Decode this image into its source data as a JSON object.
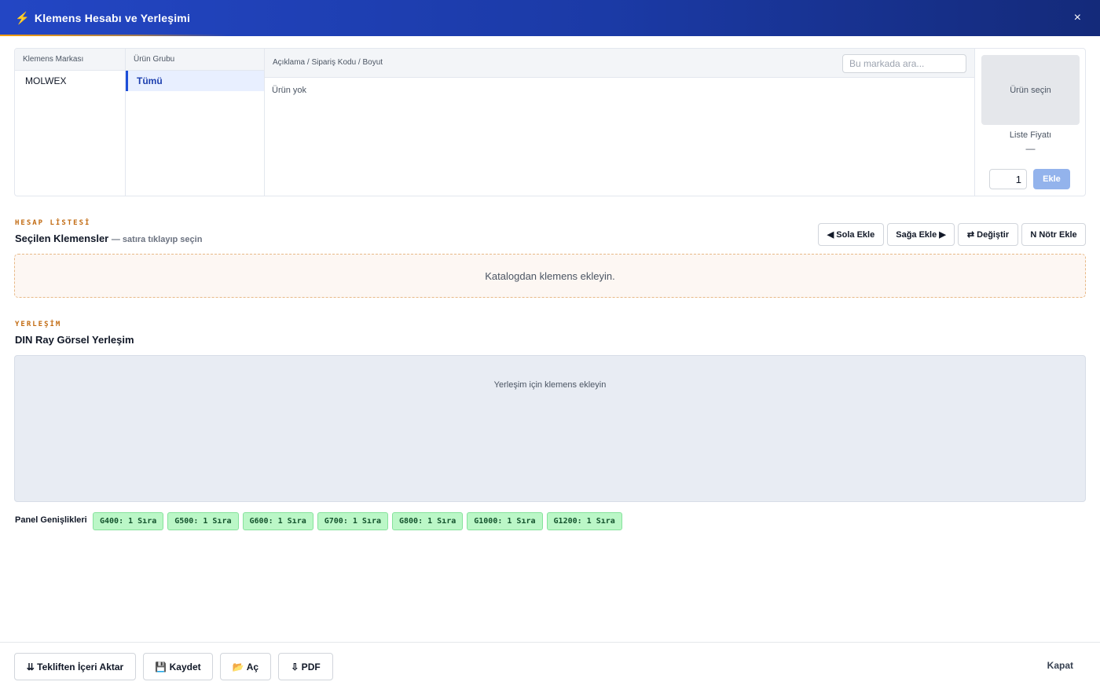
{
  "window": {
    "title": "Klemens Hesabı ve Yerleşimi",
    "title_icon": "⚡",
    "close_glyph": "×"
  },
  "catalog": {
    "brand_header": "Klemens Markası",
    "brands": [
      "MOLWEX"
    ],
    "group_header": "Ürün Grubu",
    "groups": [
      "Tümü"
    ],
    "main_header": "Açıklama / Sipariş Kodu / Boyut",
    "search_placeholder": "Bu markada ara...",
    "empty_text": "Ürün yok",
    "preview_text": "Ürün seçin",
    "price_label": "Liste Fiyatı",
    "price_value": "—",
    "quantity": "1",
    "add_label": "Ekle"
  },
  "list_section": {
    "eyebrow": "HESAP LİSTESİ",
    "title": "Seçilen Klemensler",
    "hint": "— satıra tıklayıp seçin",
    "buttons": [
      "◀ Sola Ekle",
      "Sağa Ekle ▶",
      "⇄ Değiştir",
      "N Nötr Ekle"
    ],
    "empty_text": "Katalogdan klemens ekleyin."
  },
  "layout_section": {
    "eyebrow": "YERLEŞİM",
    "title": "DIN Ray Görsel Yerleşim",
    "empty_text": "Yerleşim için klemens ekleyin"
  },
  "panels": {
    "label": "Panel Genişlikleri",
    "badges": [
      "G400: 1 Sıra",
      "G500: 1 Sıra",
      "G600: 1 Sıra",
      "G700: 1 Sıra",
      "G800: 1 Sıra",
      "G1000: 1 Sıra",
      "G1200: 1 Sıra"
    ]
  },
  "footer": {
    "import_label": "⇊ Tekliften İçeri Aktar",
    "save_label": "💾 Kaydet",
    "open_label": "📂 Aç",
    "pdf_label": "⇩ PDF",
    "close_label": "Kapat"
  },
  "colors": {
    "header_start": "#2346c4",
    "header_end": "#142a7a",
    "accent": "#f59e0b",
    "badge_bg": "#bbf7c7",
    "selected": "#1d4ed8"
  }
}
